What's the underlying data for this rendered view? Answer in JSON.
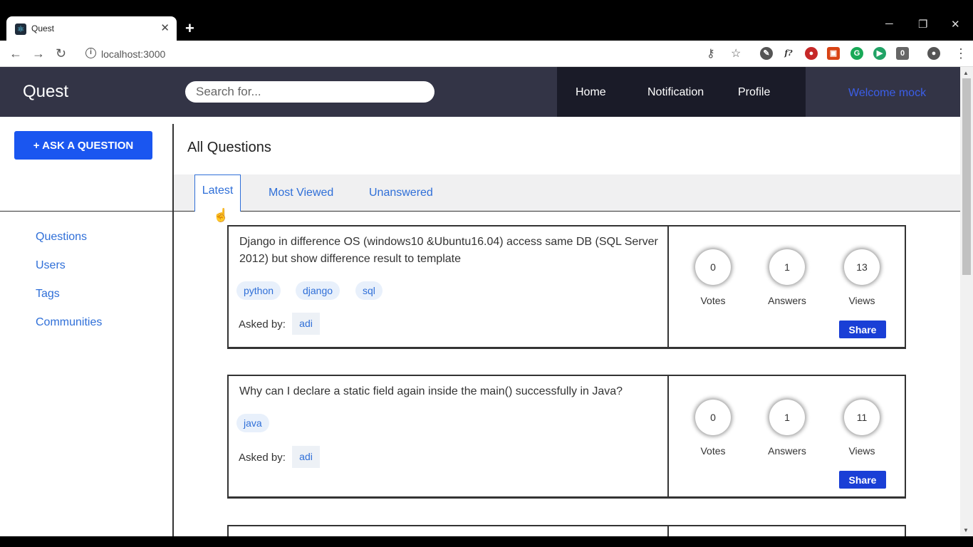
{
  "browser": {
    "tab_title": "Quest",
    "url": "localhost:3000",
    "extension_badge": "0"
  },
  "navbar": {
    "brand": "Quest",
    "search_placeholder": "Search for...",
    "menu": [
      "Home",
      "Notification",
      "Profile"
    ],
    "welcome": "Welcome mock"
  },
  "sidebar": {
    "ask_button": "+ ASK A QUESTION",
    "links": [
      "Questions",
      "Users",
      "Tags",
      "Communities"
    ]
  },
  "main": {
    "title": "All Questions",
    "tabs": [
      "Latest",
      "Most Viewed",
      "Unanswered"
    ],
    "active_tab": "Latest"
  },
  "questions": [
    {
      "title": "Django in difference OS (windows10 &Ubuntu16.04) access same DB (SQL Server 2012) but show difference result to template",
      "tags": [
        "python",
        "django",
        "sql"
      ],
      "asked_by_label": "Asked by:",
      "asker": "adi",
      "votes": "0",
      "answers": "1",
      "views": "13",
      "votes_label": "Votes",
      "answers_label": "Answers",
      "views_label": "Views",
      "share": "Share"
    },
    {
      "title": "Why can I declare a static field again inside the main() successfully in Java?",
      "tags": [
        "java"
      ],
      "asked_by_label": "Asked by:",
      "asker": "adi",
      "votes": "0",
      "answers": "1",
      "views": "11",
      "votes_label": "Votes",
      "answers_label": "Answers",
      "views_label": "Views",
      "share": "Share"
    }
  ],
  "colors": {
    "navbar": "#333446",
    "menu_bg": "#1a1b28",
    "accent_blue": "#1a56f0",
    "link_blue": "#2f6fd8",
    "share_blue": "#1a3fd6"
  }
}
